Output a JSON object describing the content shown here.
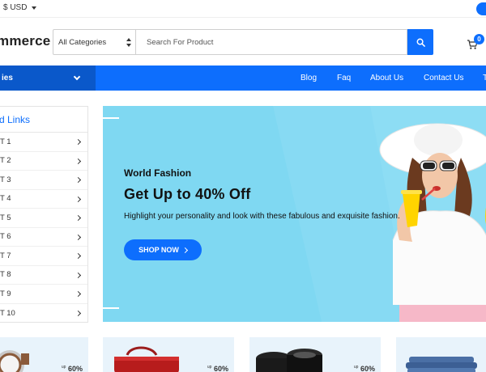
{
  "topbar": {
    "currency": "$ USD"
  },
  "header": {
    "logo": "mmerce",
    "category_select": "All Categories",
    "search_placeholder": "Search For Product",
    "cart_count": "0"
  },
  "nav": {
    "categories_label": "ies",
    "links": [
      "Blog",
      "Faq",
      "About Us",
      "Contact Us",
      "T"
    ]
  },
  "sidebar": {
    "title": "d Links",
    "items": [
      "T 1",
      "T 2",
      "T 3",
      "T 4",
      "T 5",
      "T 6",
      "T 7",
      "T 8",
      "T 9",
      "T 10"
    ]
  },
  "banner": {
    "subtitle": "World Fashion",
    "title": "Get Up to 40% Off",
    "description": "Highlight your personality and look with these fabulous and exquisite fashion.",
    "cta": "SHOP NOW",
    "bg_color": "#7fd8f2"
  },
  "cards": [
    {
      "product": "watch",
      "offer_prefix": "up",
      "offer": "60%"
    },
    {
      "product": "handbag",
      "offer_prefix": "up",
      "offer": "60%"
    },
    {
      "product": "camera-lenses",
      "offer_prefix": "up",
      "offer": "60%"
    },
    {
      "product": "jeans",
      "offer_prefix": "",
      "offer": ""
    }
  ],
  "colors": {
    "accent": "#0d6efd",
    "accent_dark": "#0a58ca"
  },
  "icons": {
    "search": "search-icon",
    "cart": "cart-icon",
    "chevron": "chevron-icon"
  }
}
